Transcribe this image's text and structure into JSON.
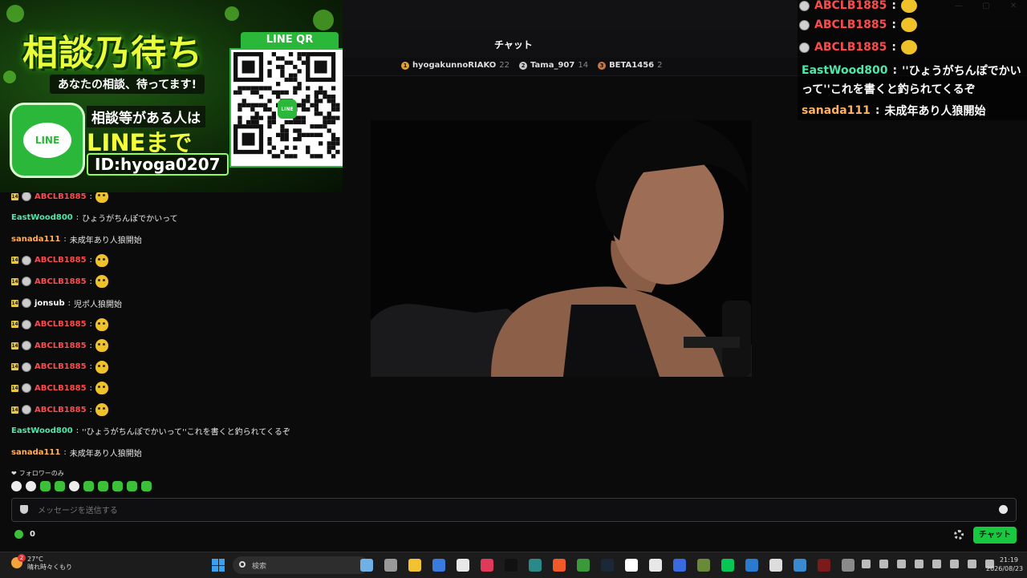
{
  "window": {
    "title": "チャット"
  },
  "ranking": [
    {
      "rank": "1",
      "name": "hyogakunnoRIAKO",
      "count": "22",
      "color": "#e0a23a"
    },
    {
      "rank": "2",
      "name": "Tama_907",
      "count": "14",
      "color": "#c9c9c9"
    },
    {
      "rank": "3",
      "name": "BETA1456",
      "count": "2",
      "color": "#c27a4a"
    }
  ],
  "banner": {
    "title": "相談乃待ち",
    "subtitle": "あなたの相談、待ってます!",
    "line_logo_text": "LINE",
    "line1": "相談等がある人は",
    "line2": "LINEまで",
    "line_id": "ID:hyoga0207",
    "qr_label": "LINE QR",
    "qr_center": "LINE"
  },
  "chat": {
    "messages": [
      {
        "user": "ABCLB1885",
        "sep": ":",
        "text": "",
        "color": "#ff4a4a",
        "badge": true,
        "emote": true
      },
      {
        "user": "EastWood800",
        "sep": ":",
        "text": "ひょうがちんぽでかいって",
        "color": "#4ee7a9",
        "badge": false,
        "emote": false
      },
      {
        "user": "sanada111",
        "sep": ":",
        "text": "未成年あり人狼開始",
        "color": "#ffb05a",
        "badge": false,
        "emote": false
      },
      {
        "user": "ABCLB1885",
        "sep": ":",
        "text": "",
        "color": "#ff4a4a",
        "badge": true,
        "emote": true
      },
      {
        "user": "ABCLB1885",
        "sep": ":",
        "text": "",
        "color": "#ff4a4a",
        "badge": true,
        "emote": true
      },
      {
        "user": "jonsub",
        "sep": ":",
        "text": "児ポ人狼開始",
        "color": "#ffffff",
        "badge": true,
        "emote": false
      },
      {
        "user": "ABCLB1885",
        "sep": ":",
        "text": "",
        "color": "#ff4a4a",
        "badge": true,
        "emote": true
      },
      {
        "user": "ABCLB1885",
        "sep": ":",
        "text": "",
        "color": "#ff4a4a",
        "badge": true,
        "emote": true
      },
      {
        "user": "ABCLB1885",
        "sep": ":",
        "text": "",
        "color": "#ff4a4a",
        "badge": true,
        "emote": true
      },
      {
        "user": "ABCLB1885",
        "sep": ":",
        "text": "",
        "color": "#ff4a4a",
        "badge": true,
        "emote": true
      },
      {
        "user": "ABCLB1885",
        "sep": ":",
        "text": "",
        "color": "#ff4a4a",
        "badge": true,
        "emote": true
      },
      {
        "user": "EastWood800",
        "sep": ":",
        "text": "''ひょうがちんぽでかいって''これを書くと釣られてくるぞ",
        "color": "#4ee7a9",
        "badge": false,
        "emote": false
      },
      {
        "user": "sanada111",
        "sep": ":",
        "text": "未成年あり人狼開始",
        "color": "#ffb05a",
        "badge": false,
        "emote": false
      }
    ],
    "sub_badge": "14",
    "follower_only": "フォロワーのみ",
    "input_placeholder": "メッセージを送信する",
    "points": "0",
    "send_label": "チャット"
  },
  "overlay": {
    "rows": [
      {
        "user": "ABCLB1885",
        "sep": ":",
        "text": "",
        "color": "#ff4a4a",
        "avatar": true,
        "emote": true
      },
      {
        "user": "ABCLB1885",
        "sep": ":",
        "text": "",
        "color": "#ff4a4a",
        "avatar": true,
        "emote": true
      },
      {
        "user": "ABCLB1885",
        "sep": ":",
        "text": "",
        "color": "#ff4a4a",
        "avatar": true,
        "emote": true
      },
      {
        "user": "EastWood800",
        "sep": ":",
        "text": "''ひょうがちんぽでかい",
        "color": "#4ee7a9",
        "avatar": false,
        "emote": false
      },
      {
        "user": "",
        "sep": "",
        "text": "って''これを書くと釣られてくるぞ",
        "color": "#ffffff",
        "avatar": false,
        "emote": false
      },
      {
        "user": "sanada111",
        "sep": ":",
        "text": "未成年あり人狼開始",
        "color": "#ffb05a",
        "avatar": false,
        "emote": false
      }
    ]
  },
  "taskbar": {
    "temperature": "27°C",
    "weather": "晴れ時々くもり",
    "weather_badge": "2",
    "search_placeholder": "検索",
    "time": "21:19",
    "date": "2026/08/23",
    "app_icons": [
      "landscape-icon",
      "task-view-icon",
      "file-explorer-icon",
      "app-icon",
      "chrome-icon",
      "app-icon",
      "tiktok-icon",
      "app-icon",
      "brave-icon",
      "app-icon",
      "steam-icon",
      "app-icon",
      "obs-icon",
      "app-icon",
      "minecraft-icon",
      "line-icon",
      "app-icon",
      "unreal-icon",
      "app-icon",
      "app-icon",
      "settings-icon"
    ],
    "app_colors": [
      "#6fb0e6",
      "#999999",
      "#f2c230",
      "#3a7be0",
      "#e8e8e8",
      "#e03a5a",
      "#111111",
      "#2a8a8a",
      "#f05a28",
      "#3a9a3a",
      "#1b2838",
      "#ffffff",
      "#e8e8e8",
      "#3a6ae0",
      "#6a8a3a",
      "#06c755",
      "#2a7ad0",
      "#dddddd",
      "#3a8ad0",
      "#7a1a1a",
      "#8a8a8a"
    ]
  }
}
